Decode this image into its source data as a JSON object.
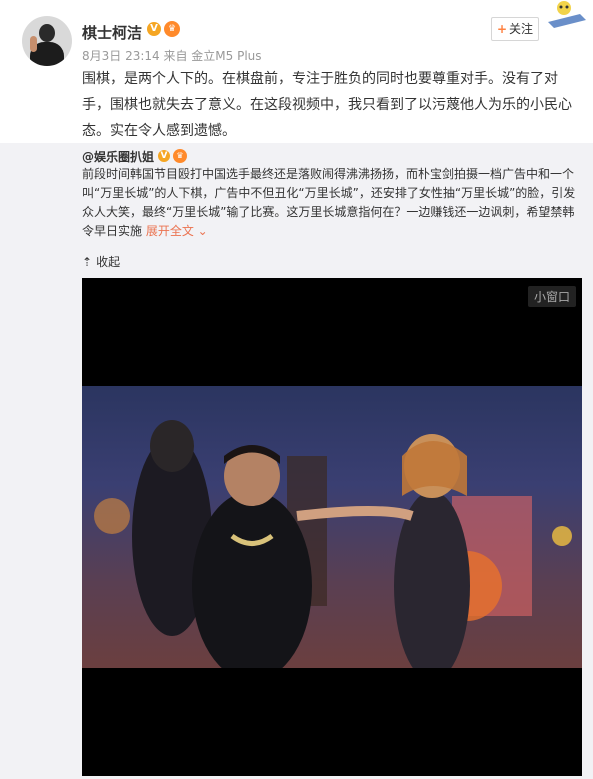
{
  "post": {
    "username": "棋士柯洁",
    "verified_badge": "V",
    "meta": "8月3日 23:14 来自 金立M5 Plus",
    "follow_label": "关注",
    "text": "围棋，是两个人下的。在棋盘前，专注于胜负的同时也要尊重对手。没有了对手，围棋也就失去了意义。在这段视频中，我只看到了以污蔑他人为乐的小民心态。实在令人感到遗憾。"
  },
  "repost": {
    "author": "@娱乐圈扒姐",
    "verified_badge": "V",
    "text": "前段时间韩国节目殴打中国选手最终还是落败闹得沸沸扬扬，而朴宝剑拍摄一档广告中和一个叫“万里长城”的人下棋，广告中不但丑化“万里长城”，还安排了女性抽“万里长城”的脸，引发众人大笑，最终“万里长城”输了比赛。这万里长城意指何在？一边赚钱还一边讽刺，希望禁韩令早日实施 ",
    "expand_label": "展开全文",
    "collapse_label": "收起"
  },
  "video": {
    "mini_window_label": "小窗口"
  },
  "icons": {
    "follow": "plus-icon",
    "expand": "chevron-down-icon",
    "collapse": "arrow-up-icon"
  },
  "colors": {
    "accent_orange": "#eb7350",
    "badge_gold": "#f5a623"
  }
}
